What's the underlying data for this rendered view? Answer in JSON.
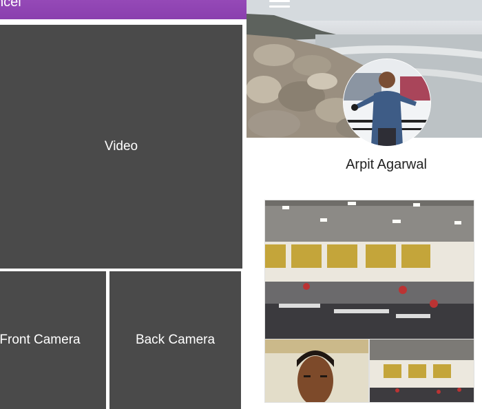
{
  "header": {
    "title": "ncel",
    "menu_icon": "menu-icon"
  },
  "left_pane": {
    "tiles": {
      "video": "Video",
      "front_camera": "Front Camera",
      "back_camera": "Back Camera"
    }
  },
  "profile": {
    "name": "Arpit Agarwal",
    "cover_photo": "beach-rocks-photo",
    "avatar": "profile-avatar-photo"
  },
  "gallery": {
    "photos": [
      "hackathon-gym-photo",
      "selfie-photo",
      "hackathon-gym-photo-2"
    ]
  },
  "colors": {
    "header": "#8e44ad",
    "tile": "#4a4a4a",
    "tile_text": "#ffffff",
    "name_text": "#222222"
  }
}
